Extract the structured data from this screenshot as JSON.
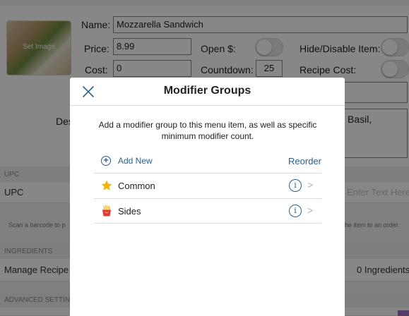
{
  "item_editor": {
    "image_caption": "Set Image",
    "name_label": "Name:",
    "name_value": "Mozzarella Sandwich",
    "price_label": "Price:",
    "price_value": "8.99",
    "open_label": "Open $:",
    "hide_label": "Hide/Disable Item:",
    "cost_label": "Cost:",
    "cost_value": "0",
    "countdown_label": "Countdown:",
    "countdown_value": "25",
    "recipe_cost_label": "Recipe Cost:",
    "description_label_partial": "Des",
    "description_value_partial": "Basil,"
  },
  "upc_section": {
    "header": "UPC",
    "row_label": "UPC",
    "placeholder": "Enter Text Here",
    "note_left": "Scan a barcode to p",
    "note_right": "he item to an order."
  },
  "ingredients_section": {
    "header": "INGREDIENTS",
    "row_label": "Manage Recipe",
    "count": "0 Ingredients"
  },
  "advanced_section": {
    "header": "ADVANCED SETTIN"
  },
  "modal": {
    "title": "Modifier Groups",
    "description": "Add a modifier group to this menu item, as well as specific minimum modifier count.",
    "add_new_label": "Add New",
    "reorder_label": "Reorder",
    "groups": [
      {
        "name": "Common",
        "icon": "star-icon"
      },
      {
        "name": "Sides",
        "icon": "fries-icon"
      }
    ]
  },
  "colors": {
    "accent": "#2b5f8e",
    "overlay": "rgba(0,0,0,0.47)",
    "star": "#f4b400",
    "fries_box": "#e03a3a"
  }
}
